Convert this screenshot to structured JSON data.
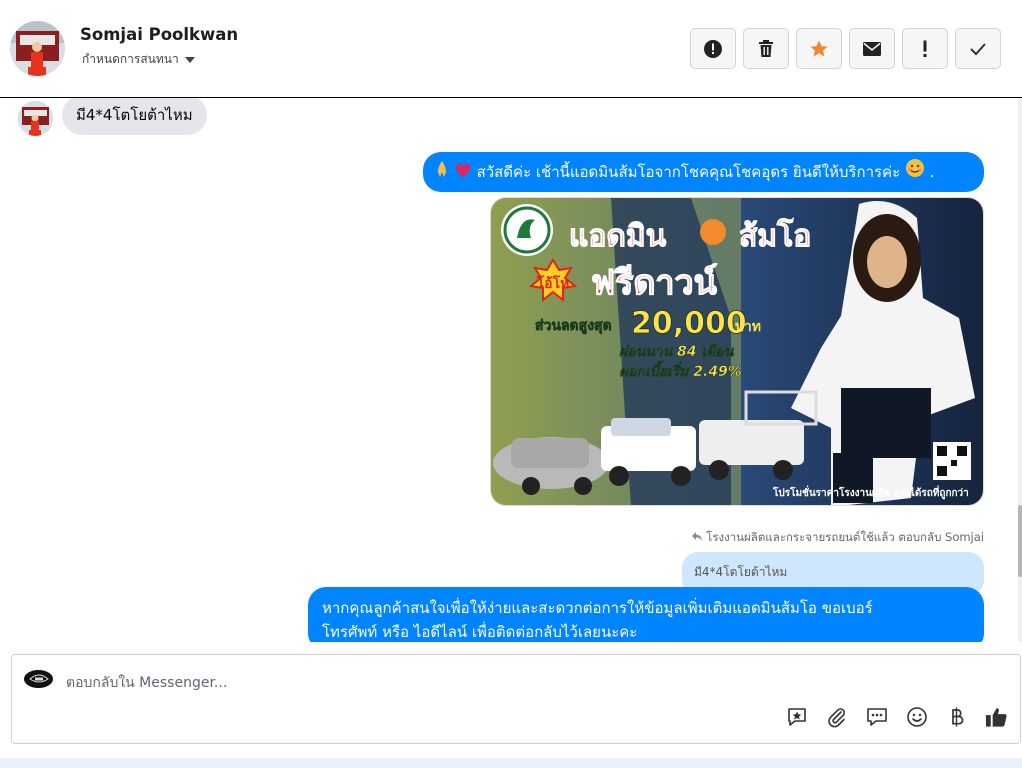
{
  "header": {
    "contact_name": "Somjai Poolkwan",
    "conversation_settings": "กำหนดการสนทนา",
    "toolbar": [
      {
        "icon": "alert-circle-icon"
      },
      {
        "icon": "trash-icon"
      },
      {
        "icon": "star-icon",
        "color": "#f5862e"
      },
      {
        "icon": "envelope-icon"
      },
      {
        "icon": "exclamation-icon"
      },
      {
        "icon": "checkmark-icon"
      }
    ]
  },
  "messages": {
    "incoming_1": "มี4*4โตโยต้าไหม",
    "outgoing_1": "สวัสดีค่ะ เช้านี้แอดมินส้มโอจากโชคคุณโชคอุดร ยินดีให้บริการค่ะ",
    "promo": {
      "headline_1": "แอดมิน",
      "headline_2": "ส้มโอ",
      "badge": "โอ้โห",
      "free_down": "ฟรีดาวน์",
      "discount_label": "ส่วนลดสูงสุด",
      "discount_value": "20,000",
      "currency": "บาท",
      "installment": "ผ่อนนาน 84 เดือน",
      "interest": "ดอกเบี้ยเริ่ม 2.49%",
      "footer": "โปรโมชั่นราคาโรงงานผลิต คุณได้รถที่ถูกกว่า"
    },
    "reply_meta": "โรงงานผลิตและกระจายรถยนต์ใช้แล้ว ตอบกลับ Somjai",
    "quoted": "มี4*4โตโยต้าไหม",
    "outgoing_2_line1": "หากคุณลูกค้าสนใจเพื่อให้ง่ายและสะดวกต่อการให้ข้อมูลเพิ่มเติมแอดมินส้มโอ ขอเบอร์",
    "outgoing_2_line2": "โทรศัพท์ หรือ ไอดีไลน์ เพื่อติดต่อกลับไว้เลยนะคะ"
  },
  "composer": {
    "placeholder": "ตอบกลับใน Messenger...",
    "tools": [
      "saved-reply-icon",
      "attachment-icon",
      "chat-bubble-icon",
      "emoji-icon",
      "baht-icon",
      "thumbs-up-icon"
    ]
  },
  "colors": {
    "accent": "#0084ff",
    "quoted_bg": "#cfe6ff",
    "incoming_bg": "#e4e6eb"
  }
}
